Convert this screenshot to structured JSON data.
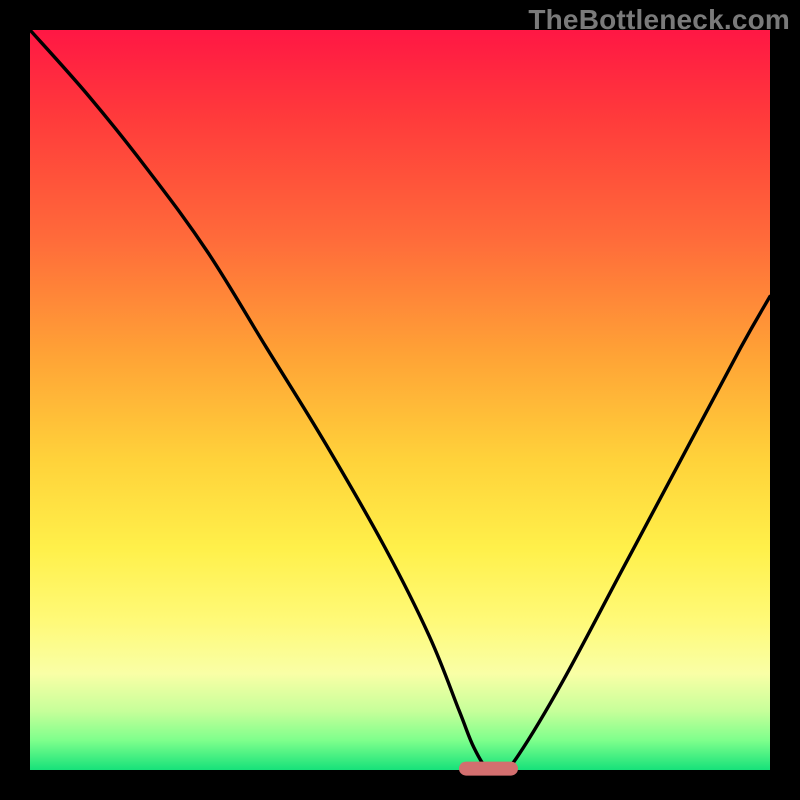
{
  "watermark": "TheBottleneck.com",
  "chart_data": {
    "type": "line",
    "title": "",
    "xlabel": "",
    "ylabel": "",
    "xlim": [
      0,
      100
    ],
    "ylim": [
      0,
      100
    ],
    "grid": false,
    "background": "rainbow-gradient (red top → green bottom)",
    "series": [
      {
        "name": "bottleneck-curve",
        "x": [
          0,
          8,
          16,
          24,
          32,
          40,
          48,
          54,
          58,
          60,
          62,
          64,
          66,
          72,
          80,
          88,
          96,
          100
        ],
        "y": [
          100,
          91,
          81,
          70,
          57,
          44,
          30,
          18,
          8,
          3,
          0,
          0,
          2,
          12,
          27,
          42,
          57,
          64
        ]
      }
    ],
    "marker": {
      "name": "optimal-point",
      "x_range": [
        58,
        66
      ],
      "y": 0,
      "color": "#d36f6f"
    }
  }
}
